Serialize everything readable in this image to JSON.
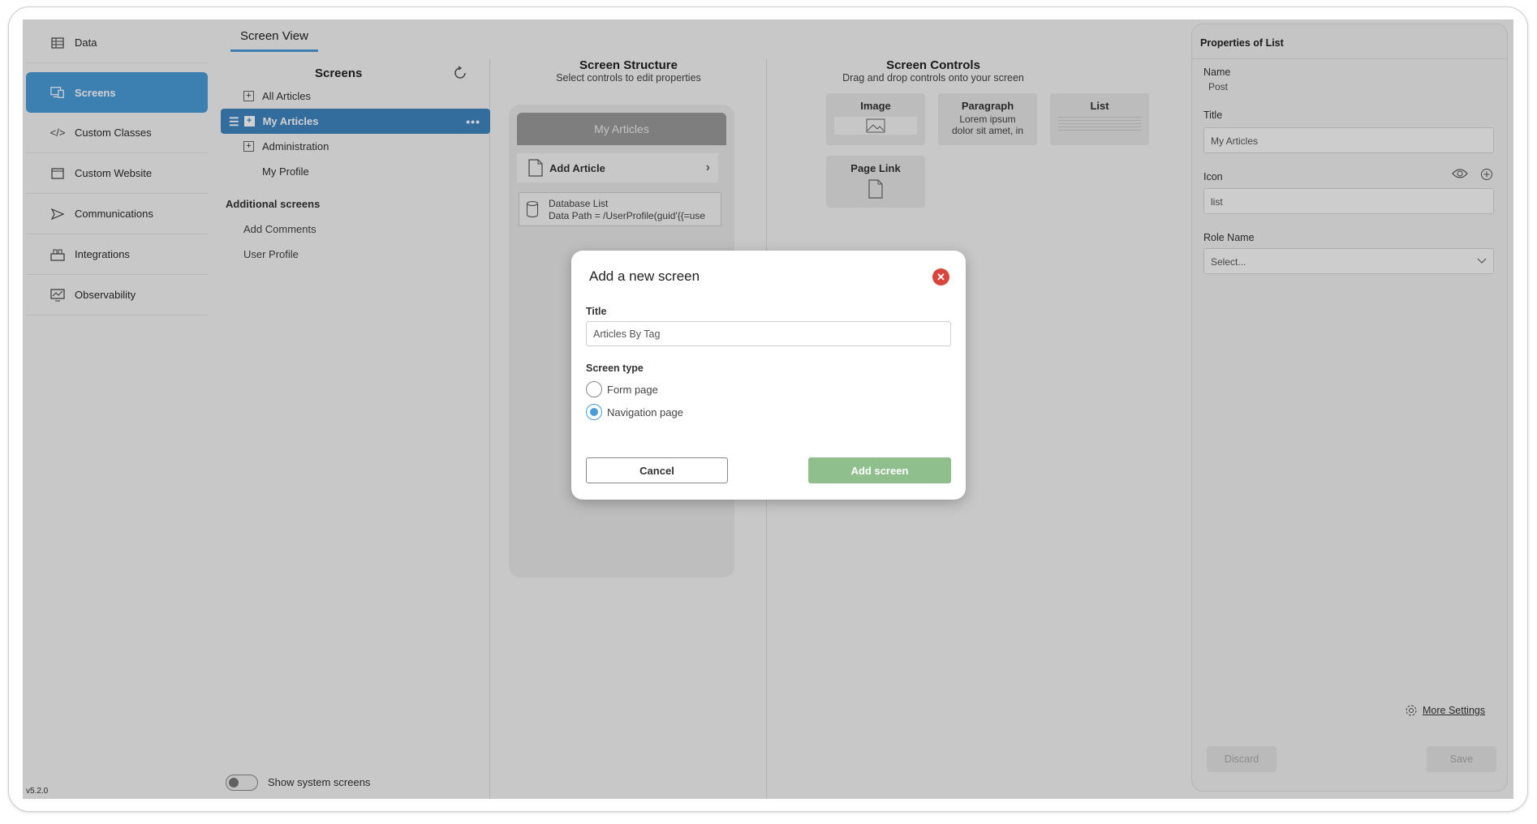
{
  "version": "v5.2.0",
  "sidebar": {
    "items": [
      {
        "label": "Data",
        "icon": "table-icon"
      },
      {
        "label": "Screens",
        "icon": "screens-icon"
      },
      {
        "label": "Custom Classes",
        "icon": "code-icon"
      },
      {
        "label": "Custom Website",
        "icon": "browser-icon"
      },
      {
        "label": "Communications",
        "icon": "send-icon"
      },
      {
        "label": "Integrations",
        "icon": "integrations-icon"
      },
      {
        "label": "Observability",
        "icon": "monitor-icon"
      }
    ]
  },
  "tabs": {
    "active": "Screen View"
  },
  "screens": {
    "title": "Screens",
    "tree": [
      {
        "label": "All Articles"
      },
      {
        "label": "My Articles"
      },
      {
        "label": "Administration"
      },
      {
        "label": "My Profile"
      }
    ],
    "additional_title": "Additional screens",
    "additional": [
      "Add Comments",
      "User Profile"
    ],
    "show_system_label": "Show system screens"
  },
  "structure": {
    "title": "Screen Structure",
    "subtitle": "Select controls to edit properties",
    "header": "My Articles",
    "row_label": "Add Article",
    "db_line1": "Database List",
    "db_line2": "Data Path = /UserProfile(guid'{{=use"
  },
  "controls": {
    "title": "Screen Controls",
    "subtitle": "Drag and drop controls onto your screen",
    "image": "Image",
    "paragraph": "Paragraph",
    "paragraph_text1": "Lorem ipsum",
    "paragraph_text2": "dolor sit amet, in",
    "list": "List",
    "page_link": "Page Link"
  },
  "properties": {
    "title": "Properties of List",
    "name_label": "Name",
    "name_value": "Post",
    "title_label": "Title",
    "title_value": "My Articles",
    "icon_label": "Icon",
    "icon_value": "list",
    "role_label": "Role Name",
    "role_value": "Select...",
    "more_settings": "More Settings",
    "discard": "Discard",
    "save": "Save"
  },
  "modal": {
    "title": "Add a new screen",
    "title_label": "Title",
    "title_value": "Articles By Tag",
    "type_label": "Screen type",
    "option_form": "Form page",
    "option_nav": "Navigation page",
    "selected": "Navigation page",
    "cancel": "Cancel",
    "add": "Add screen"
  },
  "colors": {
    "accent": "#4a9bd8",
    "add_button": "#8fbf8c",
    "close": "#d9453a"
  }
}
